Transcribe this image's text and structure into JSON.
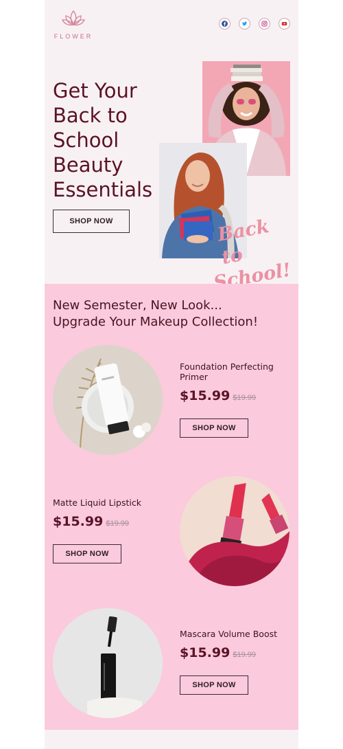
{
  "brand": {
    "name": "FLOWER",
    "color": "#c46f8a"
  },
  "socials": [
    {
      "name": "facebook-icon",
      "color": "#3b5998"
    },
    {
      "name": "twitter-icon",
      "color": "#1da1f2"
    },
    {
      "name": "instagram-icon",
      "color": "#c13584"
    },
    {
      "name": "youtube-icon",
      "color": "#d6332b"
    }
  ],
  "hero": {
    "title": "Get Your Back to School Beauty Essentials",
    "button_label": "SHOP NOW",
    "script_text_line1": "Back to",
    "script_text_line2": "School!"
  },
  "products_section": {
    "heading_line1": "New Semester, New Look...",
    "heading_line2": "Upgrade Your Makeup Collection!",
    "items": [
      {
        "name": "Foundation Perfecting Primer",
        "price": "$15.99",
        "old_price": "$19.99",
        "button_label": "SHOP NOW"
      },
      {
        "name": "Matte Liquid Lipstick",
        "price": "$15.99",
        "old_price": "$19.99",
        "button_label": "SHOP NOW"
      },
      {
        "name": "Mascara Volume Boost",
        "price": "$15.99",
        "old_price": "$19.99",
        "button_label": "SHOP NOW"
      }
    ]
  },
  "colors": {
    "page_bg": "#f8f1f3",
    "products_bg": "#fbcadd",
    "heading": "#5a1326",
    "accent_pink": "#eb91a4"
  }
}
